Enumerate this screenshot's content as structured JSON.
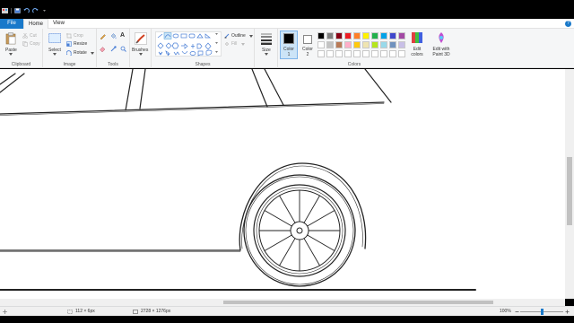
{
  "tabs": {
    "file": "File",
    "home": "Home",
    "view": "View",
    "help": "?"
  },
  "clipboard": {
    "paste": "Paste",
    "cut": "Cut",
    "copy": "Copy",
    "label": "Clipboard"
  },
  "image": {
    "select": "Select",
    "crop": "Crop",
    "resize": "Resize",
    "rotate": "Rotate",
    "label": "Image"
  },
  "tools": {
    "label": "Tools",
    "text_tool": "A"
  },
  "brushes": {
    "label": "Brushes"
  },
  "shapes": {
    "outline": "Outline",
    "fill": "Fill",
    "label": "Shapes"
  },
  "size": {
    "label": "Size"
  },
  "colors": {
    "color1": "Color 1",
    "color2": "Color 2",
    "edit": "Edit colors",
    "paint3d": "Edit with Paint 3D",
    "label": "Colors",
    "row1": [
      "#000000",
      "#7f7f7f",
      "#880015",
      "#ed1c24",
      "#ff7f27",
      "#fff200",
      "#22b14c",
      "#00a2e8",
      "#3f48cc",
      "#a349a4"
    ],
    "row2": [
      "#ffffff",
      "#c3c3c3",
      "#b97a57",
      "#ffaec9",
      "#ffc90e",
      "#efe4b0",
      "#b5e61d",
      "#99d9ea",
      "#7092be",
      "#c8bfe7"
    ],
    "row3": [
      "#ffffff",
      "#ffffff",
      "#ffffff",
      "#ffffff",
      "#ffffff",
      "#ffffff",
      "#ffffff",
      "#ffffff",
      "#ffffff",
      "#ffffff"
    ],
    "accent": "#1979ca"
  },
  "status": {
    "cursor_pos": "112 × 6px",
    "canvas_size": "2728 × 1276px",
    "zoom": "100%",
    "zoom_fraction": 0.5
  }
}
